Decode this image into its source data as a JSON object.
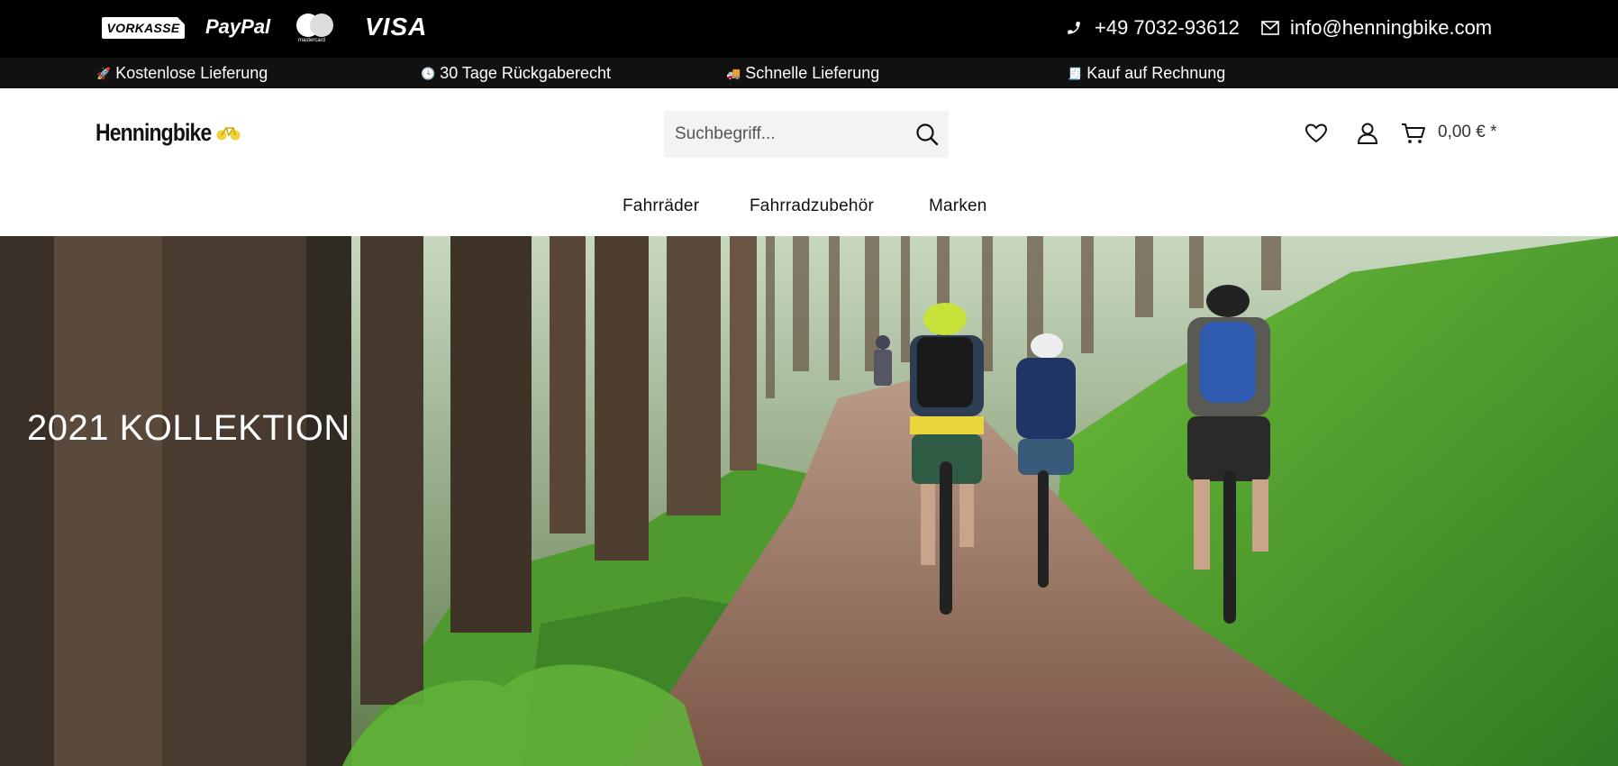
{
  "payment": {
    "vorkasse": "VORKASSE",
    "paypal": "PayPal",
    "mastercard_caption": "mastercard",
    "visa": "VISA"
  },
  "contact": {
    "phone": "+49 7032-93612",
    "email": "info@henningbike.com"
  },
  "usps": [
    {
      "icon": "rocket-icon",
      "glyph": "🚀",
      "label": "Kostenlose Lieferung"
    },
    {
      "icon": "clock-icon",
      "glyph": "🕓",
      "label": "30 Tage Rückgaberecht"
    },
    {
      "icon": "truck-icon",
      "glyph": "🚚",
      "label": "Schnelle Lieferung"
    },
    {
      "icon": "receipt-icon",
      "glyph": "🧾",
      "label": "Kauf auf Rechnung"
    }
  ],
  "header": {
    "logo": "Henningbike",
    "search_placeholder": "Suchbegriff...",
    "cart_total": "0,00 € *"
  },
  "nav": [
    "Fahrräder",
    "Fahrradzubehör",
    "Marken"
  ],
  "hero": {
    "title": "2021 KOLLEKTION"
  },
  "colors": {
    "topbar": "#000000",
    "uspbar": "#111111",
    "accent_yellow": "#f2d23a"
  }
}
